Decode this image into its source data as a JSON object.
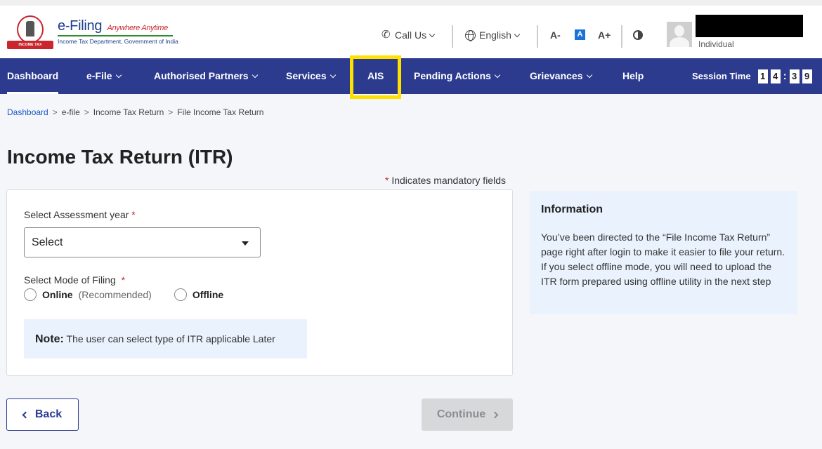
{
  "header": {
    "logo_title": "e-Filing",
    "logo_tagline": "Anywhere Anytime",
    "logo_subtitle": "Income Tax Department, Government of India",
    "emblem_text": "INCOME TAX DEPARTMENT",
    "call_us": "Call Us",
    "language": "English",
    "font_decrease": "A-",
    "font_normal": "A",
    "font_increase": "A+",
    "user_type": "Individual"
  },
  "nav": {
    "items": [
      {
        "label": "Dashboard"
      },
      {
        "label": "e-File"
      },
      {
        "label": "Authorised Partners"
      },
      {
        "label": "Services"
      },
      {
        "label": "AIS"
      },
      {
        "label": "Pending Actions"
      },
      {
        "label": "Grievances"
      },
      {
        "label": "Help"
      }
    ],
    "session_label": "Session Time",
    "session_digits": [
      "1",
      "4",
      "3",
      "9"
    ],
    "session_separator": ":"
  },
  "breadcrumb": {
    "items": [
      "Dashboard",
      "e-file",
      "Income Tax Return",
      "File Income Tax Return"
    ],
    "separator": ">"
  },
  "page": {
    "title": "Income Tax Return (ITR)",
    "mandatory_star": "*",
    "mandatory_note": "Indicates mandatory fields"
  },
  "form": {
    "ay_label": "Select Assessment year",
    "ay_value": "Select",
    "mode_label": "Select Mode of Filing",
    "required_star": "*",
    "online_label": "Online",
    "online_hint": "(Recommended)",
    "offline_label": "Offline",
    "note_title": "Note:",
    "note_text": "The user can select type of ITR applicable Later"
  },
  "info": {
    "title": "Information",
    "line1": "You’ve been directed to the “File Income Tax Return” page right after login to make it easier to file your return.",
    "line2": "If you select offline mode, you will need to upload the ITR form prepared using offline utility in the next step"
  },
  "buttons": {
    "back": "Back",
    "continue": "Continue"
  },
  "colors": {
    "nav_bg": "#2d3b8f",
    "highlight": "#ffe100",
    "accent_link": "#1a56c4",
    "info_bg": "#eaf2fd",
    "brand_red": "#c9262d"
  }
}
